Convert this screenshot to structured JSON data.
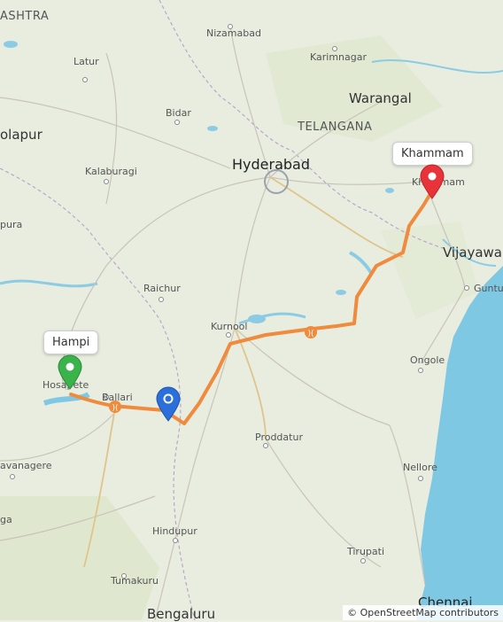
{
  "map": {
    "places": {
      "ashtra": "ASHTRA",
      "nizamabad": "Nizamabad",
      "karimnagar": "Karimnagar",
      "latur": "Latur",
      "warangal": "Warangal",
      "bidar": "Bidar",
      "telangana": "TELANGANA",
      "solapur": "olapur",
      "hyderabad": "Hyderabad",
      "kalaburagi": "Kalaburagi",
      "khammam_town": "Khammam",
      "vijayawada": "Vijayawa",
      "pura": "pura",
      "raichur": "Raichur",
      "guntur": "Guntu",
      "kurnool": "Kurnool",
      "ongole": "Ongole",
      "hosapete": "Hosapete",
      "ballari": "Ballari",
      "proddatur": "Proddatur",
      "davanagere": "avanagere",
      "nellore": "Nellore",
      "ga": "ga",
      "hindupur": "Hindupur",
      "tirupati": "Tirupati",
      "tumakuru": "Tumakuru",
      "bengaluru": "Bengaluru",
      "chennai": "Chennai"
    },
    "markers": {
      "start_label": "Hampi",
      "end_label": "Khammam"
    },
    "colors": {
      "route": "#f08a3c",
      "water": "#7ec8e3",
      "start_pin": "#3ab34a",
      "end_pin": "#e8333a",
      "current_pin": "#2a6fdb"
    },
    "attribution": "© OpenStreetMap contributors"
  }
}
